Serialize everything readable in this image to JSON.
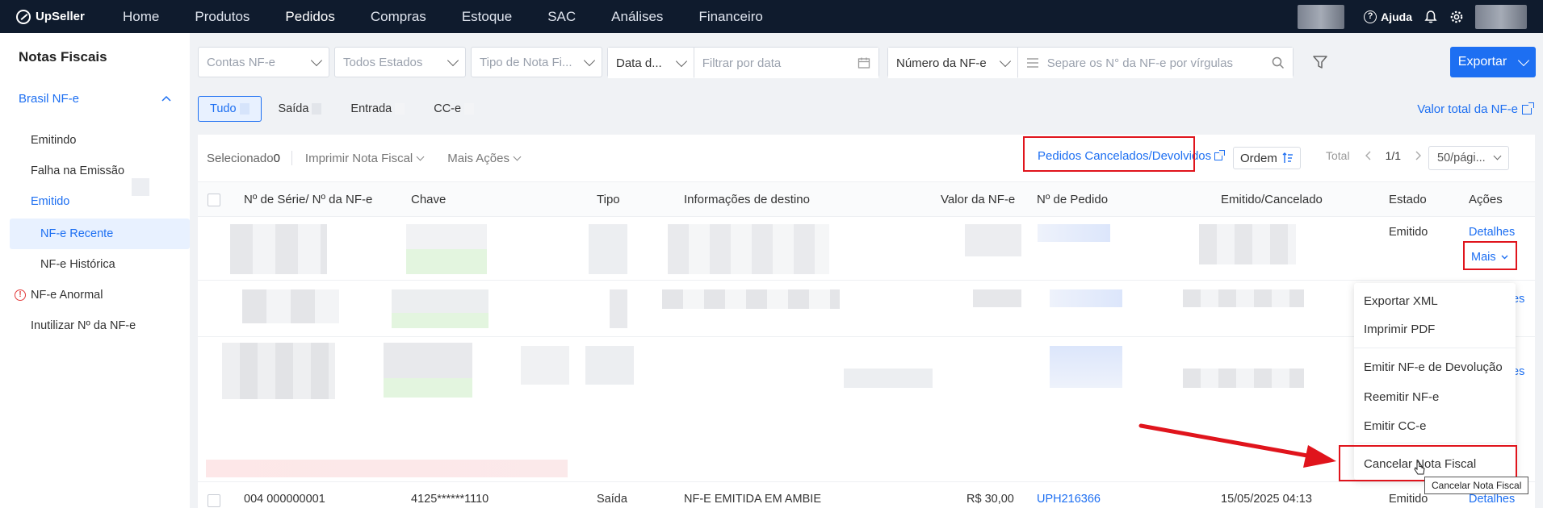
{
  "topbar": {
    "brand": "UpSeller",
    "nav": [
      "Home",
      "Produtos",
      "Pedidos",
      "Compras",
      "Estoque",
      "SAC",
      "Análises",
      "Financeiro"
    ],
    "active_nav": "Pedidos",
    "help": "Ajuda"
  },
  "sidebar": {
    "title": "Notas Fiscais",
    "group": "Brasil NF-e",
    "items": {
      "emitindo": "Emitindo",
      "falha": "Falha na Emissão",
      "emitido": "Emitido",
      "recente": "NF-e Recente",
      "historica": "NF-e Histórica",
      "anormal": "NF-e Anormal",
      "inutilizar": "Inutilizar Nº da NF-e"
    }
  },
  "filters": {
    "contas": "Contas NF-e",
    "estados": "Todos Estados",
    "tipo": "Tipo de Nota Fi...",
    "data_type": "Data d...",
    "data_placeholder": "Filtrar por data",
    "numero": "Número da NF-e",
    "search_placeholder": "Separe os N° da NF-e por vírgulas",
    "export": "Exportar"
  },
  "tabs": [
    "Tudo",
    "Saída",
    "Entrada",
    "CC-e"
  ],
  "total_link": "Valor total da NF-e",
  "toolbar": {
    "selected_label": "Selecionado",
    "selected_count": "0",
    "print": "Imprimir Nota Fiscal",
    "more_actions": "Mais Ações",
    "cancelled_link": "Pedidos Cancelados/Devolvidos",
    "order": "Ordem",
    "total": "Total",
    "page": "1/1",
    "per_page": "50/pági..."
  },
  "columns": [
    "Nº de Série/ Nº da NF-e",
    "Chave",
    "Tipo",
    "Informações de destino",
    "Valor da NF-e",
    "Nº de Pedido",
    "Emitido/Cancelado",
    "Estado",
    "Ações"
  ],
  "rows": {
    "row1": {
      "estado": "Emitido",
      "detalhes": "Detalhes",
      "mais": "Mais"
    },
    "row_bottom": {
      "serie": "004 000000001",
      "chave": "4125******1110",
      "tipo": "Saída",
      "destino": "NF-E EMITIDA EM AMBIE",
      "valor": "R$ 30,00",
      "pedido": "UPH216366",
      "data": "15/05/2025 04:13",
      "estado": "Emitido",
      "detalhes": "Detalhes"
    },
    "partial_link": "es"
  },
  "dropdown": {
    "items": [
      "Exportar XML",
      "Imprimir PDF",
      "Emitir NF-e de Devolução",
      "Reemitir NF-e",
      "Emitir CC-e",
      "Cancelar Nota Fiscal"
    ],
    "tooltip": "Cancelar  Nota Fiscal"
  },
  "colors": {
    "accent": "#1d6ff2",
    "topbar": "#0f1b2d",
    "highlight": "#e0141c"
  }
}
